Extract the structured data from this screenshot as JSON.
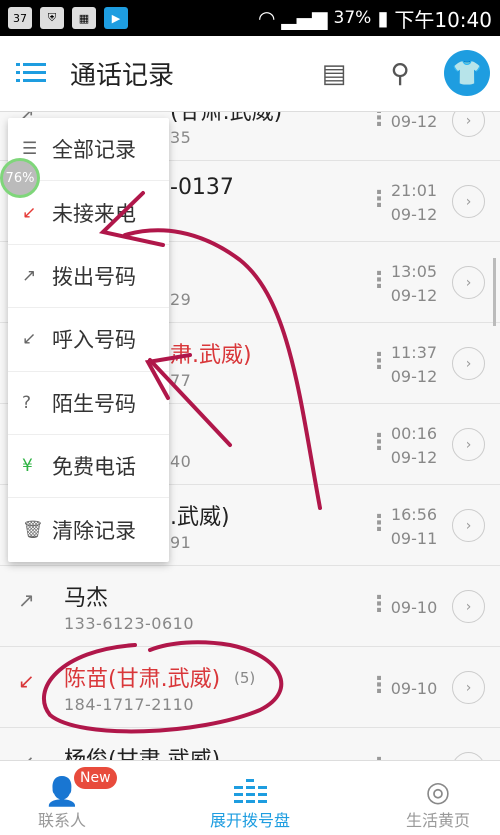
{
  "status_bar": {
    "notification_count": "37",
    "battery": "37%",
    "time": "下午10:40"
  },
  "header": {
    "title": "通话记录",
    "menu_icon": "list-icon",
    "icons": [
      "notes-icon",
      "search-icon",
      "shirt-icon"
    ]
  },
  "calls": [
    {
      "name": "(甘肃.武威)",
      "number": "35",
      "time": "",
      "date": "09-12",
      "type": "outgoing",
      "red": false
    },
    {
      "name": "-0137",
      "number": "",
      "time": "21:01",
      "date": "09-12",
      "type": "missed",
      "red": false
    },
    {
      "name": "",
      "number": "29",
      "time": "13:05",
      "date": "09-12",
      "type": "outgoing",
      "red": false
    },
    {
      "name": "肃.武威)",
      "number": "77",
      "time": "11:37",
      "date": "09-12",
      "type": "missed",
      "red": true
    },
    {
      "name": "",
      "number": "40",
      "time": "00:16",
      "date": "09-12",
      "type": "incoming",
      "red": false
    },
    {
      "name": ".武威)",
      "number": "91",
      "time": "16:56",
      "date": "09-11",
      "type": "incoming",
      "red": false
    },
    {
      "name": "马杰",
      "number": "133-6123-0610",
      "time": "",
      "date": "09-10",
      "type": "outgoing",
      "red": false
    },
    {
      "name": "陈苗(甘肃.武威)",
      "count": "(5)",
      "number": "184-1717-2110",
      "time": "",
      "date": "09-10",
      "type": "missed",
      "red": true
    },
    {
      "name": "杨俊(甘肃.武威)",
      "number": "",
      "time": "",
      "date": "",
      "type": "incoming",
      "red": false
    }
  ],
  "filter_menu": [
    {
      "icon": "☰",
      "label": "全部记录",
      "color": "#666"
    },
    {
      "icon": "↙",
      "label": "未接来电",
      "color": "#e53935"
    },
    {
      "icon": "↗",
      "label": "拨出号码",
      "color": "#666"
    },
    {
      "icon": "↙",
      "label": "呼入号码",
      "color": "#666"
    },
    {
      "icon": "?",
      "label": "陌生号码",
      "color": "#666"
    },
    {
      "icon": "¥",
      "label": "免费电话",
      "color": "#2fb344"
    },
    {
      "icon": "🗑",
      "label": "清除记录",
      "color": "#666"
    }
  ],
  "overlay_badge": "76%",
  "tabs": [
    {
      "label": "联系人",
      "badge": "New"
    },
    {
      "label": "展开拨号盘",
      "active": true
    },
    {
      "label": "生活黄页"
    }
  ],
  "colors": {
    "accent": "#1e9de0",
    "missed": "#d9373a",
    "annotation": "#b0174a"
  }
}
